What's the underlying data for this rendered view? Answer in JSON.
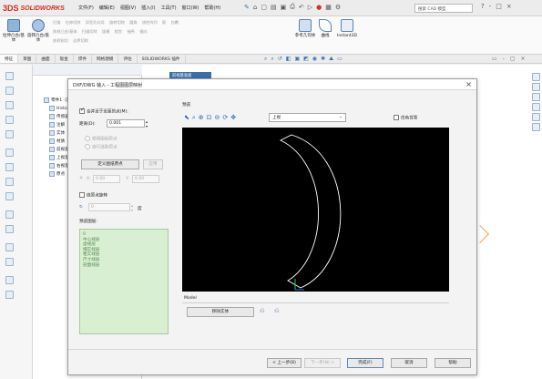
{
  "app": {
    "logo_ds": "3DS",
    "logo_text": "SOLIDWORKS"
  },
  "menus": [
    "文件(F)",
    "编辑(E)",
    "视图(V)",
    "插入(I)",
    "工具(T)",
    "窗口(W)",
    "帮助(H)"
  ],
  "search": {
    "placeholder": "搜索 CAD 模型"
  },
  "window_controls": [
    "?",
    "-",
    "□",
    "×"
  ],
  "commands": {
    "extrude_boss": "拉伸凸台/基体",
    "revolve_boss": "旋转凸台/基体",
    "ref_geometry": "参考几何体",
    "curves": "曲线",
    "instant3d": "Instant3D",
    "row1": [
      "扫描",
      "拉伸切除",
      "异型孔向导",
      "旋转切除",
      "圆角",
      "线性阵列",
      "筋",
      "包覆",
      "拔模",
      "相交",
      "抽壳",
      "镜向"
    ],
    "row2": [
      "放样凸台/基体",
      "扫描切除",
      "放样割切",
      "边界切除"
    ]
  },
  "tabs": [
    "特征",
    "草图",
    "曲面",
    "钣金",
    "焊件",
    "网格建模",
    "评估",
    "SOLIDWORKS 插件"
  ],
  "tree": {
    "root": "零件1（默认<<默认>_显示状态 1>）",
    "items": [
      "History",
      "传感器",
      "注解",
      "实体",
      "材质",
      "前视基准面",
      "上视基准面",
      "右视基准面",
      "原点"
    ]
  },
  "doc_tab": "前视基准面",
  "dialog": {
    "title": "DXF/DWG 输入 - 工程图图层映射",
    "close": "×",
    "merge_points": "合并近于近距的点(M):",
    "distance_label": "距离(D):",
    "distance_value": "0.001",
    "option_sheet": "使用图纸原点",
    "option_sheet2": "自行选取原点",
    "define_origin": "定义图纸原点",
    "apply": "应用",
    "x_label": "X:",
    "x_value": "0.00",
    "y_label": "Y:",
    "y_value": "0.00",
    "rotate_label": "绕原点旋转",
    "angle_value": "0",
    "angle_unit": "度",
    "layers_label": "预览图层:",
    "layers": [
      "0",
      "中心线层",
      "虚线层",
      "细实线层",
      "粗实线层",
      "尺寸线层",
      "剖面线层"
    ],
    "preview_label": "预览",
    "view_select": "上视",
    "white_bg": "白色背景",
    "model_label": "Model",
    "remove_entity": "移除实体",
    "prev": "< 上一步(B)",
    "next": "下一步(N) >",
    "finish": "完成(F)",
    "cancel": "取消",
    "help": "帮助"
  }
}
